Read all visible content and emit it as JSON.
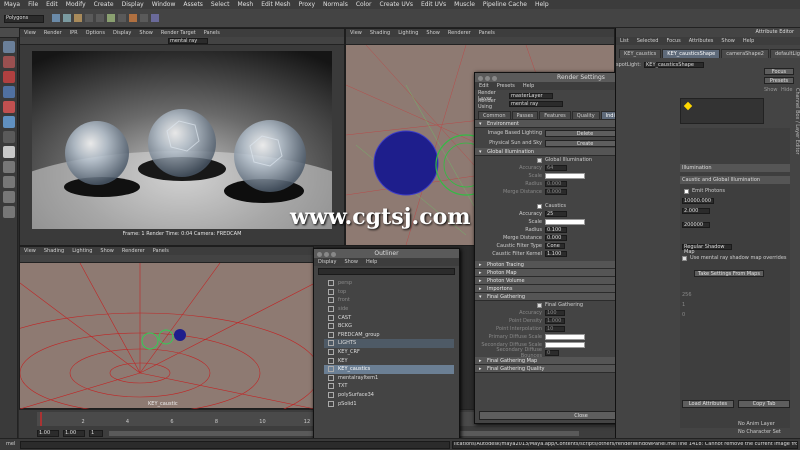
{
  "app": {
    "menu": [
      "Maya",
      "File",
      "Edit",
      "Modify",
      "Create",
      "Display",
      "Window",
      "Assets",
      "Select",
      "Mesh",
      "Edit Mesh",
      "Proxy",
      "Normals",
      "Color",
      "Create UVs",
      "Edit UVs",
      "Muscle",
      "Pipeline Cache",
      "Help"
    ],
    "mode_selector": "Polygons",
    "status_line_text": "mel"
  },
  "render_view": {
    "menu": [
      "View",
      "Render",
      "IPR",
      "Options",
      "Display",
      "Show",
      "Render Target",
      "Panels"
    ],
    "renderer_field": "mental ray",
    "info_line": "Frame: 1    Render Time: 0:04    Camera: FREDCAM"
  },
  "persp_panel": {
    "menu": [
      "View",
      "Shading",
      "Lighting",
      "Show",
      "Renderer",
      "Panels"
    ]
  },
  "bottom_panel": {
    "menu": [
      "View",
      "Shading",
      "Lighting",
      "Show",
      "Renderer",
      "Panels"
    ],
    "object_label": "KEY_caustic"
  },
  "timeline": {
    "start_fields": [
      "1.00",
      "1.00",
      "1"
    ],
    "end_fields": [
      "24",
      "24.00",
      "48.00"
    ],
    "tick_labels": [
      "2",
      "4",
      "6",
      "8",
      "10",
      "12",
      "14",
      "16",
      "18",
      "20",
      "22",
      "24"
    ],
    "no_anim_layer": "No Anim Layer",
    "no_char_set": "No Character Set"
  },
  "render_settings": {
    "title": "Render Settings",
    "menu": [
      "Edit",
      "Presets",
      "Help"
    ],
    "render_layer_label": "Render Layer",
    "render_layer_value": "masterLayer",
    "render_using_label": "Render Using",
    "render_using_value": "mental ray",
    "tabs": [
      "Common",
      "Passes",
      "Features",
      "Quality",
      "Indirect Lighting",
      "Options"
    ],
    "selected_tab": "Indirect Lighting",
    "sections": {
      "environment": "Environment",
      "ibl_label": "Image Based Lighting",
      "ibl_button": "Delete",
      "sky_label": "Physical Sun and Sky",
      "sky_button": "Create",
      "global_illumination": "Global Illumination",
      "gi_checkbox": "Global Illumination",
      "gi_rows": [
        "Accuracy",
        "Scale",
        "Radius",
        "Merge Distance"
      ],
      "gi_accuracy": "64",
      "gi_radius": "0.000",
      "gi_merge": "0.000",
      "caustics_checkbox": "Caustics",
      "accuracy_label": "Accuracy",
      "accuracy_value": "25",
      "scale_label": "Scale",
      "radius_label": "Radius",
      "radius_value": "0.100",
      "merge_label": "Merge Distance",
      "merge_value": "0.000",
      "filter_type_label": "Caustic Filter Type",
      "filter_type_value": "Cone",
      "filter_kernel_label": "Caustic Filter Kernel",
      "filter_kernel_value": "1.100",
      "photon_tracing": "Photon Tracing",
      "photon_map": "Photon Map",
      "photon_volume": "Photon Volume",
      "importons": "Importons",
      "final_gathering": "Final Gathering",
      "fg_checkbox": "Final Gathering",
      "fg_rows": [
        "Accuracy",
        "Point Density",
        "Point Interpolation",
        "Primary Diffuse Scale",
        "Secondary Diffuse Scale",
        "Secondary Diffuse Bounces"
      ],
      "fg_accuracy": "100",
      "fg_density": "1.000",
      "fg_interp": "10",
      "fg_bounces": "0",
      "fg_map": "Final Gathering Map",
      "fg_quality": "Final Gathering Quality"
    },
    "close_button": "Close"
  },
  "outliner": {
    "title": "Outliner",
    "menu": [
      "Display",
      "Show",
      "Help"
    ],
    "items": [
      {
        "label": "persp",
        "state": "dim"
      },
      {
        "label": "top",
        "state": "dim"
      },
      {
        "label": "front",
        "state": "dim"
      },
      {
        "label": "side",
        "state": "dim"
      },
      {
        "label": "CAST",
        "state": ""
      },
      {
        "label": "BCKG",
        "state": ""
      },
      {
        "label": "FREDCAM_group",
        "state": ""
      },
      {
        "label": "LIGHTS",
        "state": "hl"
      },
      {
        "label": "KEY_CRF",
        "state": ""
      },
      {
        "label": "KEY",
        "state": ""
      },
      {
        "label": "KEY_caustics",
        "state": "sel"
      },
      {
        "label": "mentalrayItem1",
        "state": ""
      },
      {
        "label": "TXT",
        "state": ""
      },
      {
        "label": "polySurface34",
        "state": ""
      },
      {
        "label": "pSolid1",
        "state": ""
      }
    ]
  },
  "attribute_editor": {
    "title": "Attribute Editor",
    "menu": [
      "List",
      "Selected",
      "Focus",
      "Attributes",
      "Show",
      "Help"
    ],
    "tabs": [
      "KEY_caustics",
      "KEY_causticsShape",
      "cameraShape2",
      "defaultLig"
    ],
    "selected_tab": "KEY_causticsShape",
    "node_label": "spotLight:",
    "node_name": "KEY_causticsShape",
    "focus_button": "Focus",
    "presets_button": "Presets",
    "show_label": "Show",
    "hide_label": "Hide",
    "section_illumination": "Illumination",
    "section_caustics": "Caustic and Global Illumination",
    "emit_photons": "Emit Photons",
    "photon_intensity": "10000.000",
    "exponent": "2.000",
    "caustic_photons": "200000",
    "shadow_map_option": "Regular Shadow Map",
    "mr_shadow_label": "Use mental ray shadow map overrides",
    "take_settings_button": "Take Settings From Maps",
    "fields": [
      "256",
      "1",
      "0"
    ],
    "load_attributes": "Load Attributes",
    "copy_tab": "Copy Tab",
    "side_tabs": "Channel Box / Layer Editor"
  },
  "status_bar": {
    "message": "lications/Autodesk/maya2013/Maya.app/Contents/scripts/others/renderWindowPanel.mel line 1418: Cannot remove the current image from the ren"
  },
  "watermark": "www.cgtsj.com",
  "colors": {
    "accent": "#6b7f94",
    "tab_selected": "#5e6a7a",
    "viewport_bg": "#8e7a72",
    "grid_red": "#c02525"
  }
}
